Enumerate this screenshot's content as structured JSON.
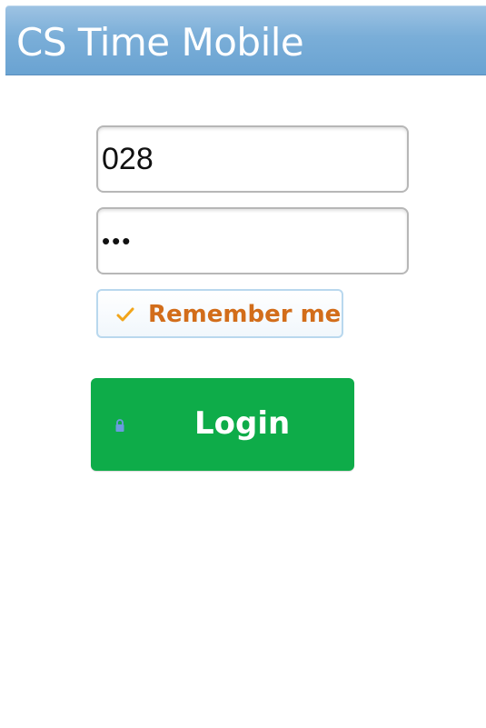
{
  "header": {
    "title": "CS Time Mobile",
    "background_color": "#7aaed8",
    "text_color": "#ffffff"
  },
  "login_form": {
    "username": {
      "value": "028"
    },
    "password": {
      "masked_value": "•••"
    },
    "remember_me": {
      "label": "Remember me",
      "checked": true,
      "icon": "checkmark-icon",
      "label_color": "#d26d1a"
    },
    "login_button": {
      "label": "Login",
      "icon": "lock-icon",
      "background_color": "#0eac49"
    }
  }
}
